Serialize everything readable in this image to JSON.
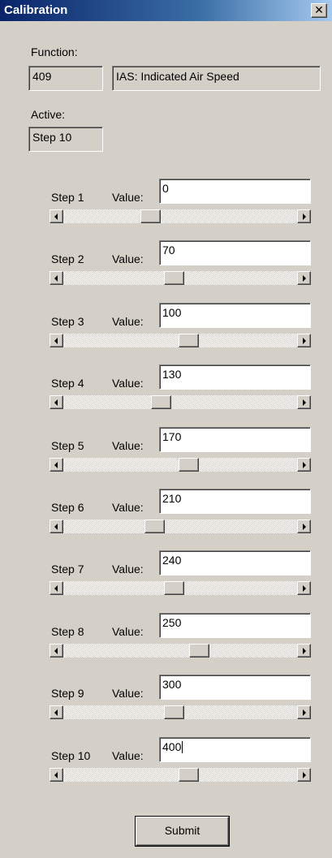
{
  "window": {
    "title": "Calibration",
    "close_icon": "close-icon",
    "close_glyph": "✕"
  },
  "function": {
    "label": "Function:",
    "id": "409",
    "name": "IAS: Indicated Air Speed"
  },
  "active": {
    "label": "Active:",
    "value": "Step 10"
  },
  "value_label": "Value:",
  "steps": [
    {
      "label": "Step 1",
      "value": "0",
      "slider_position": 0.36
    },
    {
      "label": "Step 2",
      "value": "70",
      "slider_position": 0.47
    },
    {
      "label": "Step 3",
      "value": "100",
      "slider_position": 0.54
    },
    {
      "label": "Step 4",
      "value": "130",
      "slider_position": 0.41
    },
    {
      "label": "Step 5",
      "value": "170",
      "slider_position": 0.54
    },
    {
      "label": "Step 6",
      "value": "210",
      "slider_position": 0.38
    },
    {
      "label": "Step 7",
      "value": "240",
      "slider_position": 0.47
    },
    {
      "label": "Step 8",
      "value": "250",
      "slider_position": 0.59
    },
    {
      "label": "Step 9",
      "value": "300",
      "slider_position": 0.47
    },
    {
      "label": "Step 10",
      "value": "400",
      "slider_position": 0.54
    }
  ],
  "submit_label": "Submit",
  "colors": {
    "face": "#d4d0c8",
    "title_bar": "#0a246a"
  }
}
